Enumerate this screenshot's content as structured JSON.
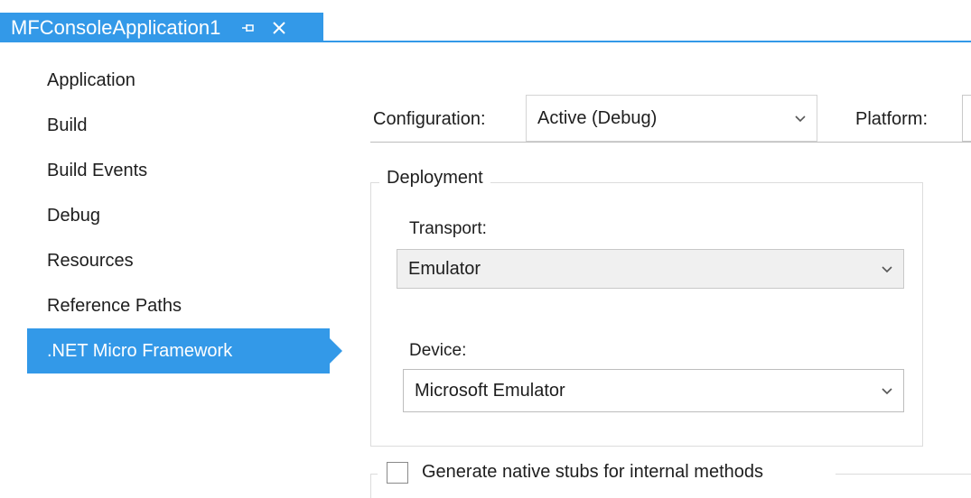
{
  "tab": {
    "title": "MFConsoleApplication1",
    "pin_glyph": "⯐",
    "close_glyph": "✕"
  },
  "sidebar": {
    "items": [
      {
        "label": "Application"
      },
      {
        "label": "Build"
      },
      {
        "label": "Build Events"
      },
      {
        "label": "Debug"
      },
      {
        "label": "Resources"
      },
      {
        "label": "Reference Paths"
      },
      {
        "label": ".NET Micro Framework",
        "selected": true
      }
    ]
  },
  "config": {
    "configuration_label": "Configuration:",
    "configuration_value": "Active (Debug)",
    "platform_label": "Platform:"
  },
  "deployment": {
    "legend": "Deployment",
    "transport_label": "Transport:",
    "transport_value": "Emulator",
    "device_label": "Device:",
    "device_value": "Microsoft Emulator"
  },
  "options": {
    "native_stubs_label": "Generate native stubs for internal methods",
    "native_stubs_checked": false
  },
  "colors": {
    "accent": "#3399e8"
  },
  "icons": {
    "dropdown": "chevron-down-icon",
    "pin": "pin-icon",
    "close": "close-icon"
  }
}
